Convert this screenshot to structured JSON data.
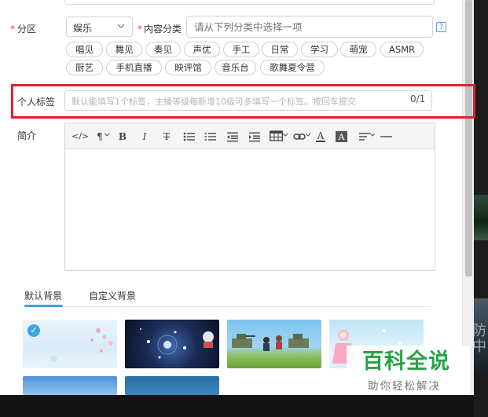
{
  "background_text": "防中",
  "form": {
    "partition": {
      "required_mark": "*",
      "label": "分区",
      "value": "娱乐"
    },
    "content_category": {
      "required_mark": "*",
      "label": "内容分类",
      "placeholder": "请从下列分类中选择一项",
      "help": "?"
    },
    "category_tags": [
      "唱见",
      "舞见",
      "奏见",
      "声优",
      "手工",
      "日常",
      "学习",
      "萌宠",
      "ASMR",
      "厨艺",
      "手机直播",
      "映评馆",
      "音乐台",
      "歌舞夏令营"
    ],
    "personal_tags": {
      "label": "个人标签",
      "placeholder": "默认能填写1个标签，主播等级每新增10级可多填写一个标签。按回车提交",
      "count": "0/1"
    },
    "intro": {
      "label": "简介",
      "toolbar": [
        "html-source",
        "paragraph",
        "bold",
        "italic",
        "strikethrough",
        "unordered-list",
        "ordered-list",
        "outdent",
        "indent",
        "table",
        "link",
        "font-color",
        "background-color",
        "align",
        "horizontal-rule"
      ]
    }
  },
  "background": {
    "tabs": [
      {
        "label": "默认背景",
        "active": true
      },
      {
        "label": "自定义背景",
        "active": false
      }
    ],
    "thumbnails": [
      "sakura-snow",
      "night-planet",
      "tank-field",
      "pink-girl",
      "blue-sky",
      "deep-blue"
    ],
    "selected_mark": "✓"
  },
  "watermark": {
    "title": "百科全说",
    "subtitle": "助你轻松解决"
  },
  "colors": {
    "accent": "#3ba4d8",
    "highlight_box": "#e4202a",
    "required": "#ee4433",
    "watermark_green": "#26a346"
  }
}
